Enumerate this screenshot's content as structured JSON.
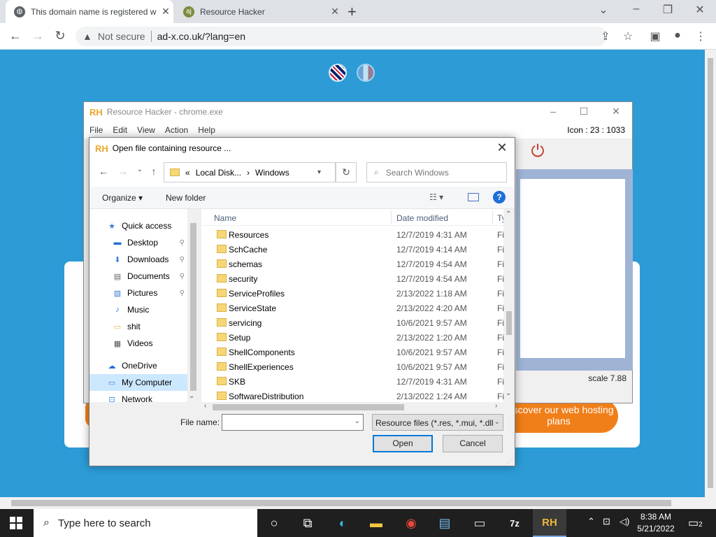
{
  "browser": {
    "tabs": [
      {
        "title": "This domain name is registered w",
        "close": "✕"
      },
      {
        "title": "Resource Hacker",
        "close": "✕"
      }
    ],
    "new_tab": "+",
    "window_controls": [
      "⌄",
      "–",
      "❐",
      "✕"
    ],
    "back": "←",
    "forward": "→",
    "reload": "↻",
    "security_label": "Not secure",
    "url": "ad-x.co.uk/?lang=en",
    "icons": [
      "share-icon",
      "star-icon",
      "side-panel-icon",
      "profile-icon",
      "menu-icon"
    ]
  },
  "page": {
    "cta": "Discover our web hosting plans"
  },
  "resource_hacker": {
    "logo": "RH",
    "title": "Resource Hacker - chrome.exe",
    "menu": [
      "File",
      "Edit",
      "View",
      "Action",
      "Help"
    ],
    "icon_info": "Icon : 23 : 1033",
    "scale": "scale 7.88",
    "controls": [
      "–",
      "☐",
      "✕"
    ]
  },
  "dialog": {
    "logo": "RH",
    "title": "Open file containing resource ...",
    "close": "✕",
    "breadcrumb": [
      "«",
      "Local Disk...",
      "›",
      "Windows"
    ],
    "search_placeholder": "Search Windows",
    "organize": "Organize ▾",
    "new_folder": "New folder",
    "help": "?",
    "nav": [
      {
        "label": "Quick access",
        "icon": "star-icon",
        "indent": 1
      },
      {
        "label": "Desktop",
        "icon": "desktop-icon",
        "indent": 2,
        "pinned": true
      },
      {
        "label": "Downloads",
        "icon": "download-icon",
        "indent": 2,
        "pinned": true
      },
      {
        "label": "Documents",
        "icon": "document-icon",
        "indent": 2,
        "pinned": true
      },
      {
        "label": "Pictures",
        "icon": "picture-icon",
        "indent": 2,
        "pinned": true
      },
      {
        "label": "Music",
        "icon": "music-icon",
        "indent": 2
      },
      {
        "label": "shit",
        "icon": "folder-icon",
        "indent": 2
      },
      {
        "label": "Videos",
        "icon": "video-icon",
        "indent": 2
      },
      {
        "label": "OneDrive",
        "icon": "cloud-icon",
        "indent": 1
      },
      {
        "label": "My Computer",
        "icon": "computer-icon",
        "indent": 1,
        "selected": true
      },
      {
        "label": "Network",
        "icon": "network-icon",
        "indent": 1
      }
    ],
    "columns": {
      "name": "Name",
      "date": "Date modified",
      "type": "Ty"
    },
    "files": [
      {
        "name": "Resources",
        "date": "12/7/2019 4:31 AM",
        "type": "Fi"
      },
      {
        "name": "SchCache",
        "date": "12/7/2019 4:14 AM",
        "type": "Fi"
      },
      {
        "name": "schemas",
        "date": "12/7/2019 4:54 AM",
        "type": "Fi"
      },
      {
        "name": "security",
        "date": "12/7/2019 4:54 AM",
        "type": "Fi"
      },
      {
        "name": "ServiceProfiles",
        "date": "2/13/2022 1:18 AM",
        "type": "Fi"
      },
      {
        "name": "ServiceState",
        "date": "2/13/2022 4:20 AM",
        "type": "Fi"
      },
      {
        "name": "servicing",
        "date": "10/6/2021 9:57 AM",
        "type": "Fi"
      },
      {
        "name": "Setup",
        "date": "2/13/2022 1:20 AM",
        "type": "Fi"
      },
      {
        "name": "ShellComponents",
        "date": "10/6/2021 9:57 AM",
        "type": "Fi"
      },
      {
        "name": "ShellExperiences",
        "date": "10/6/2021 9:57 AM",
        "type": "Fi"
      },
      {
        "name": "SKB",
        "date": "12/7/2019 4:31 AM",
        "type": "Fi"
      },
      {
        "name": "SoftwareDistribution",
        "date": "2/13/2022 1:24 AM",
        "type": "Fi"
      }
    ],
    "file_name_label": "File name:",
    "file_name_value": "",
    "file_type": "Resource files (*.res, *.mui, *.dll",
    "open": "Open",
    "cancel": "Cancel"
  },
  "taskbar": {
    "search_placeholder": "Type here to search",
    "apps": [
      "task-view-icon",
      "edge-icon",
      "file-explorer-icon",
      "chrome-icon",
      "control-panel-icon",
      "terminal-icon",
      "7zip-icon",
      "resource-hacker-icon"
    ],
    "time": "8:38 AM",
    "date": "5/21/2022",
    "notifications": "2"
  }
}
